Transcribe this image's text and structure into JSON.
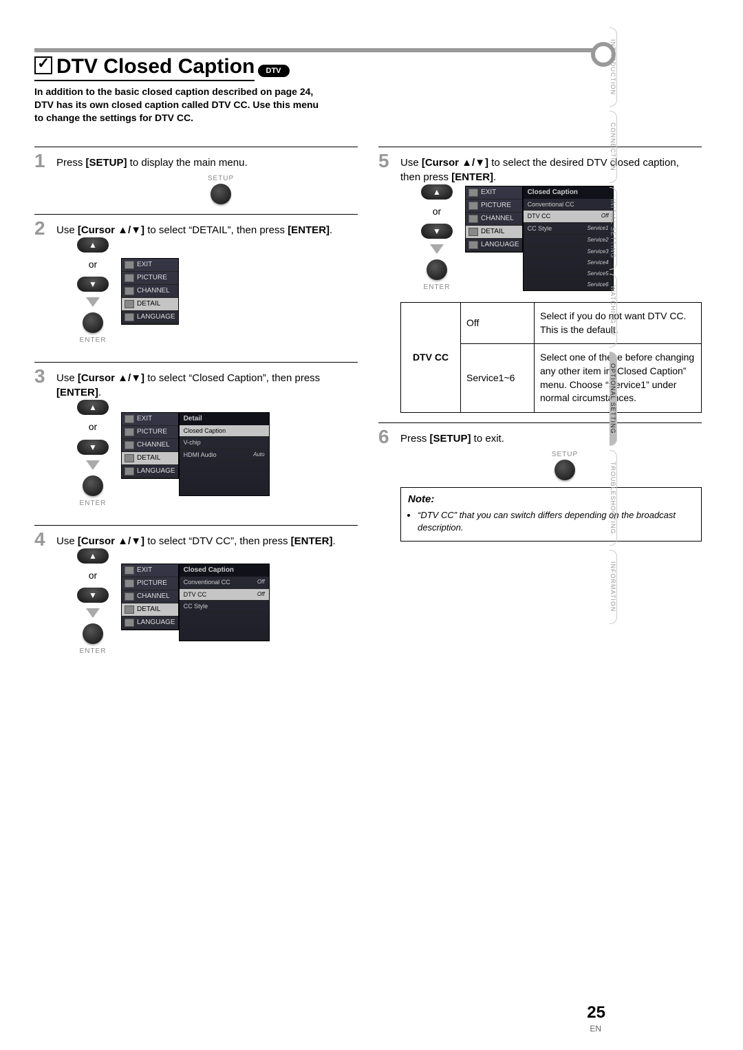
{
  "page": {
    "title": "DTV Closed Caption",
    "badge": "DTV",
    "intro": "In addition to the basic closed caption described on page 24, DTV has its own closed caption called DTV CC. Use this menu to change the settings for DTV CC.",
    "number": "25",
    "lang": "EN"
  },
  "side_tabs": [
    "INTRODUCTION",
    "CONNECTION",
    "INITIAL  SETTING",
    "WATCHING  TV",
    "OPTIONAL  SETTING",
    "TROUBLESHOOTING",
    "INFORMATION"
  ],
  "remote": {
    "setup_label": "SETUP",
    "enter_label": "ENTER",
    "or": "or"
  },
  "osd_menu_items": [
    "EXIT",
    "PICTURE",
    "CHANNEL",
    "DETAIL",
    "LANGUAGE"
  ],
  "steps": {
    "s1": "Press [SETUP] to display the main menu.",
    "s2_a": "Use [Cursor ▲/▼] to select “DETAIL”, then press ",
    "s2_b": "[ENTER].",
    "s3_a": "Use [Cursor ▲/▼] to select “Closed Caption”, then press ",
    "s3_b": "[ENTER].",
    "s4_a": "Use [Cursor ▲/▼] to select “DTV CC”, then press ",
    "s4_b": "[ENTER].",
    "s5_a": "Use [Cursor ▲/▼] to select the desired DTV closed caption, then press ",
    "s5_b": "[ENTER].",
    "s6": "Press [SETUP] to exit."
  },
  "panels": {
    "detail_header": "Detail",
    "detail_items": [
      {
        "label": "Closed Caption",
        "hilite": true
      },
      {
        "label": "V-chip"
      },
      {
        "label": "HDMI Audio",
        "val": "Auto"
      }
    ],
    "cc_header": "Closed Caption",
    "cc_items": [
      {
        "label": "Conventional CC",
        "val": "Off"
      },
      {
        "label": "DTV CC",
        "val": "Off",
        "hilite": true
      },
      {
        "label": "CC Style"
      }
    ],
    "dtv_header": "Closed Caption",
    "dtv_items": [
      {
        "label": "Conventional CC"
      },
      {
        "label": "DTV CC",
        "val": "Off",
        "hilite": true
      },
      {
        "label": "CC Style",
        "sub": [
          "Service1",
          "Service2",
          "Service3",
          "Service4",
          "Service5",
          "Service6"
        ]
      }
    ]
  },
  "table": {
    "header": "DTV CC",
    "rows": [
      {
        "opt": "Off",
        "desc": "Select if you do not want DTV CC. This is the default."
      },
      {
        "opt": "Service1~6",
        "desc": "Select one of these before changing any other item in “Closed Caption” menu. Choose “Service1” under normal circumstances."
      }
    ]
  },
  "note": {
    "heading": "Note:",
    "item": "“DTV CC” that you can switch differs depending on the broadcast description."
  }
}
